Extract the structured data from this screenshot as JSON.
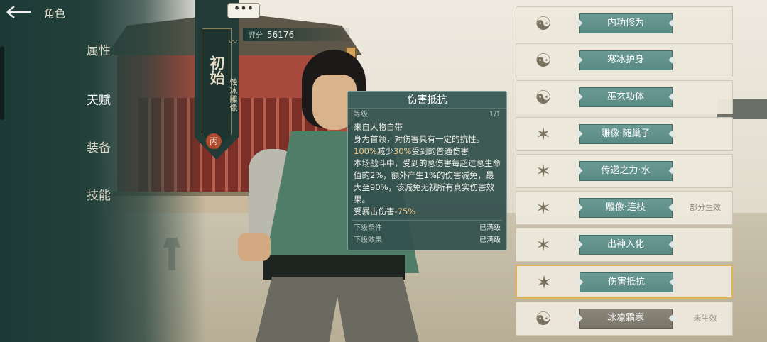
{
  "header": {
    "back_icon": "back-arrow-icon",
    "title": "角色",
    "chat_icon": "ellipsis-icon",
    "chat_label": "•••"
  },
  "nav": {
    "items": [
      {
        "label": "属性"
      },
      {
        "label": "天赋"
      },
      {
        "label": "装备"
      },
      {
        "label": "技能"
      }
    ],
    "active": "天赋"
  },
  "character": {
    "rank_title": "初始",
    "sub_title": "蚀冰雕像",
    "grade": "丙",
    "score_label": "评分",
    "score_value": "56176"
  },
  "tooltip": {
    "title": "伤害抵抗",
    "level_label": "等级",
    "level_value": "1/1",
    "lines": [
      "来自人物自带",
      "身为首领，对伤害具有一定的抗性。"
    ],
    "line3_pre": "100%",
    "line3_mid": "减少",
    "line3_hl": "30%",
    "line3_post": "受到的普通伤害",
    "para": "本场战斗中，受到的总伤害每超过总生命值的2%，额外产生1%的伤害减免，最大至90%，该减免无视所有真实伤害效果。",
    "crit_pre": "受暴击伤害",
    "crit_hl": "-75%",
    "next_cond_label": "下级条件",
    "next_cond_value": "已满级",
    "next_effect_label": "下级效果",
    "next_effect_value": "已满级"
  },
  "talents": [
    {
      "label": "内功修为",
      "icon": "meditating-monk-icon",
      "status": "",
      "enabled": true
    },
    {
      "label": "寒冰护身",
      "icon": "meditating-monk-icon",
      "status": "",
      "enabled": true
    },
    {
      "label": "巫玄功体",
      "icon": "meditating-monk-icon",
      "status": "",
      "enabled": true
    },
    {
      "label": "雕像·随巢子",
      "icon": "multi-armed-statue-icon",
      "status": "",
      "enabled": true
    },
    {
      "label": "传递之力·水",
      "icon": "multi-armed-statue-icon",
      "status": "",
      "enabled": true
    },
    {
      "label": "雕像·连枝",
      "icon": "multi-armed-statue-icon",
      "status": "部分生效",
      "enabled": true
    },
    {
      "label": "出神入化",
      "icon": "multi-armed-statue-icon",
      "status": "",
      "enabled": true
    },
    {
      "label": "伤害抵抗",
      "icon": "multi-armed-statue-icon",
      "status": "",
      "enabled": true,
      "selected": true
    },
    {
      "label": "冰凛霜寒",
      "icon": "meditating-monk-icon",
      "status": "未生效",
      "enabled": false
    }
  ]
}
